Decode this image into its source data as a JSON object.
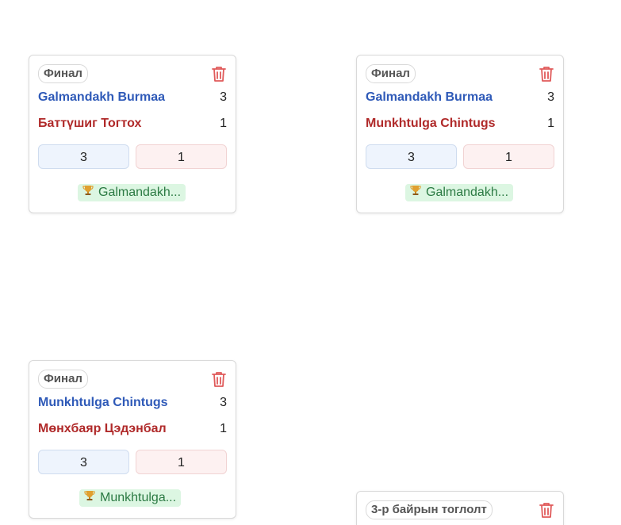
{
  "colors": {
    "player_a": "#2f5ab8",
    "player_b": "#b02a2a",
    "winner_bg": "#dcf6e2",
    "trash": "#e05a5a"
  },
  "matches": [
    {
      "round": "Финал",
      "player_a": "Galmandakh Burmaa",
      "player_b": "Баттүшиг Тогтох",
      "score_a": "3",
      "score_b": "1",
      "input_a": "3",
      "input_b": "1",
      "winner": "Galmandakh..."
    },
    {
      "round": "Финал",
      "player_a": "Galmandakh Burmaa",
      "player_b": "Munkhtulga Chintugs",
      "score_a": "3",
      "score_b": "1",
      "input_a": "3",
      "input_b": "1",
      "winner": "Galmandakh..."
    },
    {
      "round": "Финал",
      "player_a": "Munkhtulga Chintugs",
      "player_b": "Мөнхбаяр Цэдэнбал",
      "score_a": "3",
      "score_b": "1",
      "input_a": "3",
      "input_b": "1",
      "winner": "Munkhtulga..."
    },
    {
      "round": "3-р байрын тоглолт"
    }
  ],
  "icons": {
    "delete": "trash-icon",
    "winner": "trophy-icon"
  }
}
